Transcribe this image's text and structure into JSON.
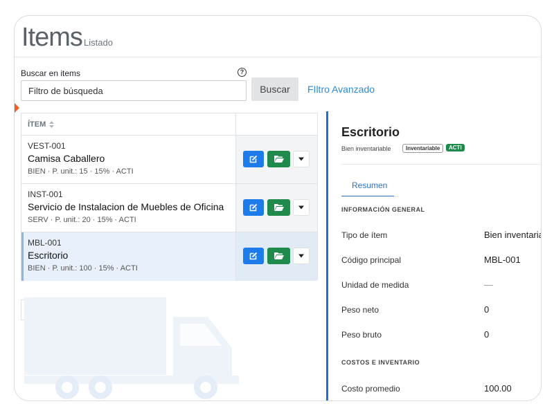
{
  "header": {
    "title": "Items",
    "subtitle": "Listado"
  },
  "search": {
    "label": "Buscar en items",
    "placeholder": "Filtro de búsqueda",
    "button_label": "Buscar",
    "advanced_label": "FIltro Avanzado"
  },
  "list": {
    "column_header": "ÍTEM",
    "rows": [
      {
        "code": "VEST-001",
        "name": "Camisa Caballero",
        "meta": "BIEN · P. unit.: 15 · 15% · ACTI"
      },
      {
        "code": "INST-001",
        "name": "Servicio de Instalacion de Muebles de Oficina",
        "meta": "SERV · P. unit.: 20 · 15% · ACTI"
      },
      {
        "code": "MBL-001",
        "name": "Escritorio",
        "meta": "BIEN · P. unit.: 100 · 15% · ACTI"
      }
    ]
  },
  "detail": {
    "title": "Escritorio",
    "subtitle": "Bien inventariable",
    "badge_inventariable": "Inventariable",
    "badge_status": "ACTI",
    "tab": "Resumen",
    "section_general": "INFORMACIÓN GENERAL",
    "fields": [
      {
        "label": "Tipo de ítem",
        "value": "Bien inventariable"
      },
      {
        "label": "Código principal",
        "value": "MBL-001"
      },
      {
        "label": "Unidad de medida",
        "value": "—"
      },
      {
        "label": "Peso neto",
        "value": "0"
      },
      {
        "label": "Peso bruto",
        "value": "0"
      }
    ],
    "section_costs": "COSTOS E INVENTARIO",
    "cost_fields": [
      {
        "label": "Costo promedio",
        "value": "100.00"
      }
    ]
  },
  "colors": {
    "primary_blue": "#1d7bea",
    "success_green": "#1f8a4c",
    "link_blue": "#2c8bd6",
    "accent_orange": "#e8622c"
  },
  "icons": {
    "edit": "edit-icon",
    "open": "folder-open-icon",
    "menu": "caret-down-icon",
    "help": "help-icon",
    "sort": "sort-icon"
  }
}
